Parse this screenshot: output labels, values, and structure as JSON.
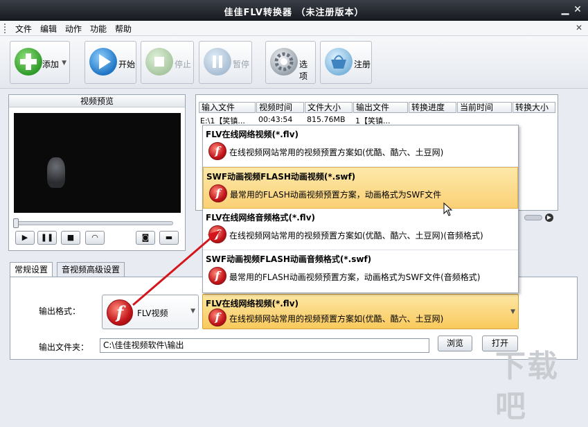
{
  "window": {
    "title": "佳佳FLV转换器  （未注册版本）"
  },
  "menu": {
    "items": [
      "文件",
      "编辑",
      "动作",
      "功能",
      "帮助"
    ],
    "close": "✕"
  },
  "toolbar": {
    "add": "添加",
    "start": "开始",
    "stop": "停止",
    "pause": "暂停",
    "options": "选项",
    "register": "注册"
  },
  "preview": {
    "title": "视频预览"
  },
  "table": {
    "headers": [
      "输入文件",
      "视频时间",
      "文件大小",
      "输出文件",
      "转换进度",
      "当前时间",
      "转换大小"
    ],
    "rows": [
      {
        "input": "E:\\1【笑镇...",
        "duration": "00:43:54",
        "size": "815.76MB",
        "output": "1【笑镇..."
      }
    ]
  },
  "tabs": [
    "常规设置",
    "音视频高级设置"
  ],
  "settings": {
    "output_format_label": "输出格式：",
    "output_folder_label": "输出文件夹：",
    "format_left": "FLV视频",
    "selected_title": "FLV在线网络视频(*.flv)",
    "selected_desc": "在线视频网站常用的视频预置方案如(优酷、酷六、土豆网)",
    "output_folder": "C:\\佳佳视频软件\\输出",
    "browse": "浏览",
    "open": "打开"
  },
  "dropdown": [
    {
      "title": "FLV在线网络视频(*.flv)",
      "desc": "在线视频网站常用的视频预置方案如(优酷、酷六、土豆网)"
    },
    {
      "title": "SWF动画视频FLASH动画视频(*.swf)",
      "desc": "最常用的FLASH动画视频预置方案，动画格式为SWF文件"
    },
    {
      "title": "FLV在线网络音频格式(*.flv)",
      "desc": "在线视频网站常用的视频预置方案如(优酷、酷六、土豆网)(音频格式)"
    },
    {
      "title": "SWF动画视频FLASH动画音频格式(*.swf)",
      "desc": "最常用的FLASH动画视频预置方案，动画格式为SWF文件(音频格式)"
    }
  ],
  "colors": {
    "accent": "#fbd076",
    "title_bar": "#16191e",
    "arrow": "#d4161c"
  },
  "icons": [
    "add-icon",
    "play-icon",
    "stop-icon",
    "pause-icon",
    "gear-icon",
    "basket-icon",
    "flash-icon"
  ]
}
